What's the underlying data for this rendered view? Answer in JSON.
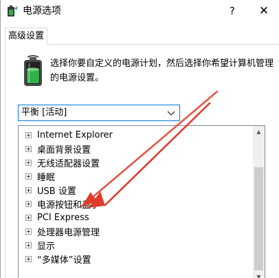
{
  "window": {
    "title": "电源选项",
    "help_label": "?",
    "close_label": "✕"
  },
  "tabs": [
    {
      "label": "高级设置"
    }
  ],
  "description": {
    "line1": "选择你要自定义的电源计划，然后选择你希望计算机管理",
    "line2": "的电源设置。"
  },
  "plan_select": {
    "selected": "平衡 [活动]",
    "icon": "chevron-down-icon"
  },
  "tree": {
    "items": [
      {
        "label": "Internet Explorer"
      },
      {
        "label": "桌面背景设置"
      },
      {
        "label": "无线适配器设置"
      },
      {
        "label": "睡眠"
      },
      {
        "label": "USB 设置"
      },
      {
        "label": "电源按钮和盖子"
      },
      {
        "label": "PCI Express"
      },
      {
        "label": "处理器电源管理"
      },
      {
        "label": "显示"
      },
      {
        "label": "“多媒体”设置"
      }
    ]
  },
  "scrollbar": {
    "up_label": "▲",
    "down_label": "▼"
  },
  "colors": {
    "accent": "#0078d7",
    "annotation_arrow": "#e03a2a",
    "battery_green": "#2fb04a"
  }
}
